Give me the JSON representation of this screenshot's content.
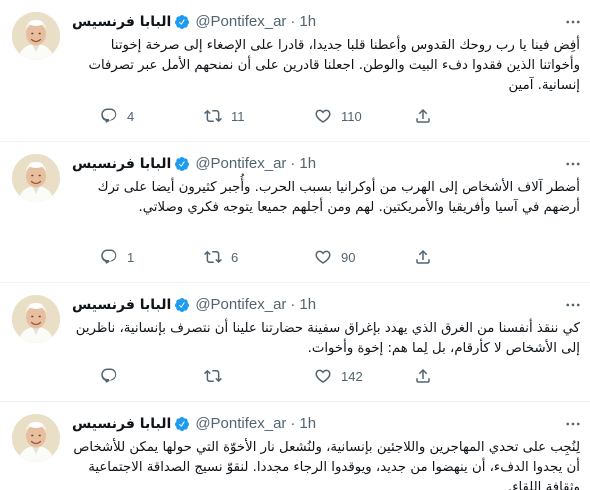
{
  "tweets": [
    {
      "name": "البابا فرنسيس",
      "handle": "@Pontifex_ar",
      "separator": "·",
      "time": "1h",
      "text": "أفِض فينا يا رب روحك القدوس وأعطنا قلبا جديدا، قادرا على الإصغاء إلى صرخة إخوتنا وأخواتنا الذين فقدوا دفء البيت والوطن. اجعلنا قادرين على أن نمنحهم الأمل عبر تصرفات إنسانية. آمين",
      "replies": "4",
      "retweets": "11",
      "likes": "110"
    },
    {
      "name": "البابا فرنسيس",
      "handle": "@Pontifex_ar",
      "separator": "·",
      "time": "1h",
      "text": "أضطر آلاف الأشخاص إلى الهرب من أوكرانيا بسبب الحرب. وأُجبر كثيرون أيضا على ترك أرضهم في آسيا وأفريقيا والأمريكتين. لهم ومن أجلهم جميعا يتوجه فكري وصلاتي.",
      "replies": "1",
      "retweets": "6",
      "likes": "90"
    },
    {
      "name": "البابا فرنسيس",
      "handle": "@Pontifex_ar",
      "separator": "·",
      "time": "1h",
      "text": "كي ننقذ أنفسنا من الغرق الذي يهدد بإغراق سفينة حضارتنا علينا أن نتصرف بإنسانية، ناظرين إلى الأشخاص لا كأرقام، بل لِما هم: إخوة وأخوات.",
      "replies": "",
      "retweets": "",
      "likes": "142"
    },
    {
      "name": "البابا فرنسيس",
      "handle": "@Pontifex_ar",
      "separator": "·",
      "time": "1h",
      "text": "لِنُجِب على تحدي المهاجرين واللاجئين بإنسانية، ولنُشعل نار الأخوّة التي حولها يمكن للأشخاص أن يجدوا الدفء، أن ينهضوا من جديد، ويوقدوا الرجاء مجددا. لنقوّ نسيج الصداقة الاجتماعية وثقافة اللقاء."
    }
  ],
  "colors": {
    "text": "#0f1419",
    "secondary": "#536471",
    "verified": "#1d9bf0",
    "divider": "#eff3f4"
  },
  "icons": {
    "avatar": "pope-portrait-avatar",
    "verified": "verified-badge-icon",
    "more": "more-options-icon",
    "reply": "reply-icon",
    "retweet": "retweet-icon",
    "like": "heart-icon",
    "share": "share-icon"
  }
}
